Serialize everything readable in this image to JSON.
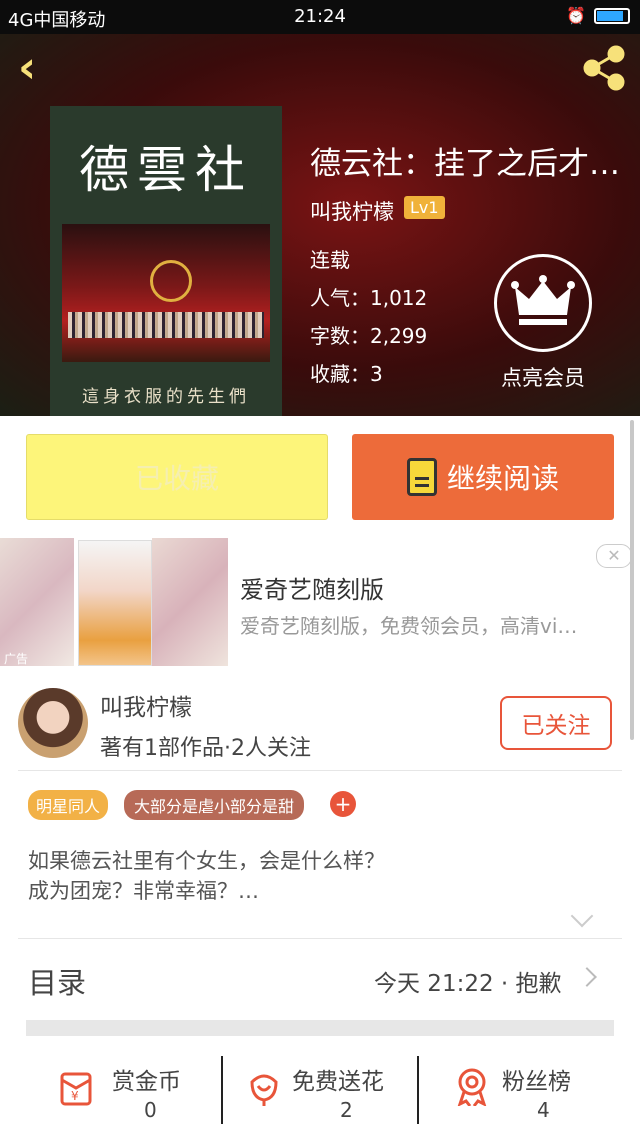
{
  "status": {
    "carrier": "4G中国移动",
    "time": "21:24"
  },
  "book": {
    "cover_title": "德雲社",
    "cover_caption": "這身衣服的先生們",
    "title": "德云社：挂了之后才…",
    "author": "叫我柠檬",
    "level": "Lv1",
    "status": "连载",
    "popularity": "人气：1,012",
    "word_count": "字数：2,299",
    "favorites": "收藏：3"
  },
  "vip": {
    "label": "点亮会员"
  },
  "actions": {
    "collected_label": "已收藏",
    "read_label": "继续阅读"
  },
  "ad": {
    "label": "广告",
    "title": "爱奇艺随刻版",
    "desc": "爱奇艺随刻版，免费领会员，高清vi…",
    "close": "✕"
  },
  "author_card": {
    "name": "叫我柠檬",
    "info": "著有1部作品·2人关注",
    "follow_label": "已关注"
  },
  "tags": [
    "明星同人",
    "大部分是虐小部分是甜"
  ],
  "description_lines": [
    "如果德云社里有个女生，会是什么样？",
    "成为团宠？非常幸福？…"
  ],
  "toc": {
    "label": "目录",
    "latest": "今天 21:22 · 抱歉"
  },
  "bottom_bar": [
    {
      "label": "赏金币",
      "count": "0",
      "icon": "red-envelope-icon"
    },
    {
      "label": "免费送花",
      "count": "2",
      "icon": "flower-icon"
    },
    {
      "label": "粉丝榜",
      "count": "4",
      "icon": "medal-icon"
    }
  ],
  "colors": {
    "accent": "#ED6B3A",
    "collect_bg": "#FDF57A",
    "tag_yellow": "#F2B146",
    "tag_brown": "#B76A57",
    "icon_red": "#E8553A"
  }
}
